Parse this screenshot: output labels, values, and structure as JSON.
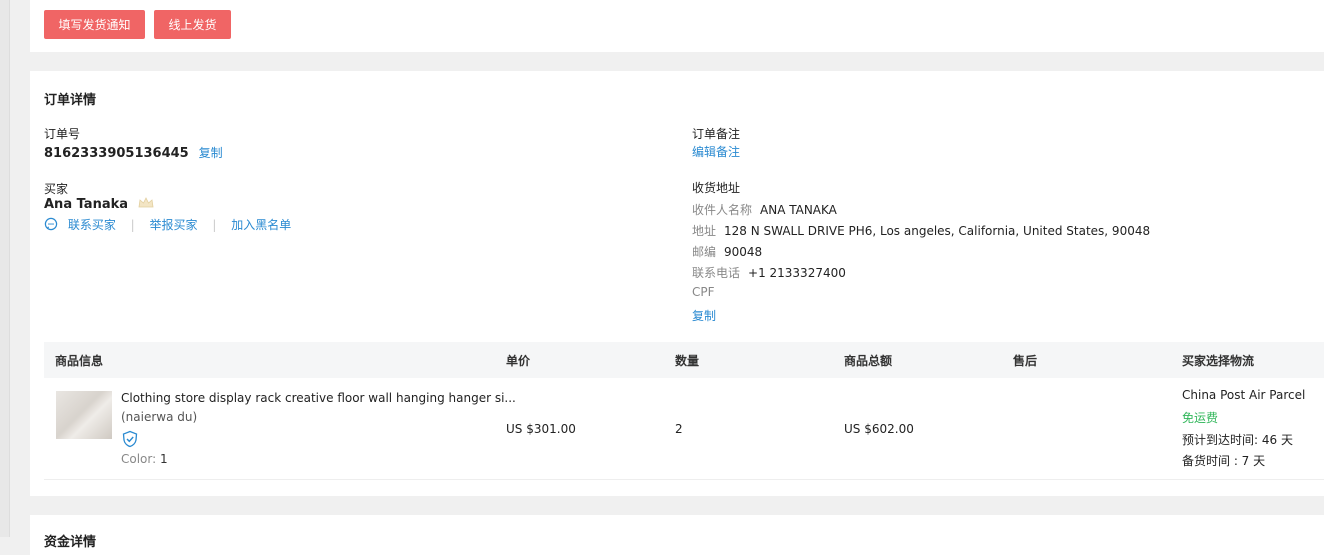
{
  "top_actions": {
    "fill_notice_label": "填写发货通知",
    "online_ship_label": "线上发货"
  },
  "order": {
    "section_title": "订单详情",
    "order_no_label": "订单号",
    "order_no": "8162333905136445",
    "copy_label": "复制",
    "buyer_label": "买家",
    "buyer_name": "Ana Tanaka",
    "buyer_badge_icon": "crown-icon",
    "contact_buyer": "联系买家",
    "report_buyer": "举报买家",
    "add_blacklist": "加入黑名单",
    "remark_label": "订单备注",
    "edit_remark": "编辑备注",
    "shipping_label": "收货地址",
    "recipient_key": "收件人名称",
    "recipient_value": "ANA TANAKA",
    "address_key": "地址",
    "address_value": "128 N SWALL DRIVE PH6, Los angeles, California, United States, 90048",
    "zip_key": "邮编",
    "zip_value": "90048",
    "phone_key": "联系电话",
    "phone_value": "+1 2133327400",
    "cpf_key": "CPF",
    "address_copy": "复制"
  },
  "table": {
    "headers": [
      "商品信息",
      "单价",
      "数量",
      "商品总额",
      "售后",
      "买家选择物流"
    ],
    "row": {
      "title": "Clothing store display rack creative floor wall hanging hanger si...",
      "store": "(naierwa du)",
      "shield_icon": "shield-check-icon",
      "color_key": "Color:",
      "color_value": "1",
      "unit_price": "US $301.00",
      "quantity": "2",
      "total": "US $602.00",
      "logistics_name": "China Post Air Parcel",
      "logistics_fee": "免运费",
      "eta": "预计到达时间: 46 天",
      "prep_time": "备货时间 : 7 天"
    }
  },
  "funds": {
    "section_title": "资金详情"
  },
  "colors": {
    "primary_button": "#f06565",
    "link": "#2a8ad1",
    "free_shipping": "#32b75b"
  }
}
